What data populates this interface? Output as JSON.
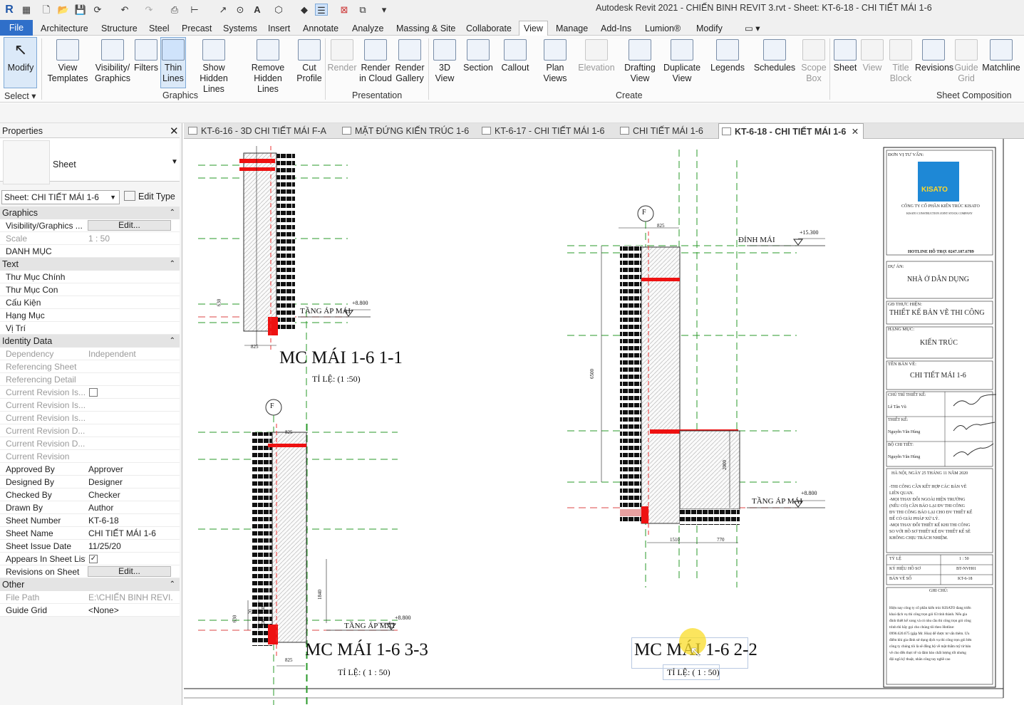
{
  "app": {
    "title": "Autodesk Revit 2021 - CHIẾN BINH REVIT 3.rvt - Sheet: KT-6-18 - CHI TIẾT MÁI 1-6"
  },
  "ribbon_tabs": [
    "File",
    "Architecture",
    "Structure",
    "Steel",
    "Precast",
    "Systems",
    "Insert",
    "Annotate",
    "Analyze",
    "Massing & Site",
    "Collaborate",
    "View",
    "Manage",
    "Add-Ins",
    "Lumion®",
    "Modify"
  ],
  "ribbon": {
    "modify": "Modify",
    "select": "Select",
    "graphics": {
      "label": "Graphics",
      "view_templates_1": "View",
      "view_templates_2": "Templates",
      "visibility_1": "Visibility/",
      "visibility_2": "Graphics",
      "filters": "Filters",
      "thin_1": "Thin",
      "thin_2": "Lines",
      "show_1": "Show",
      "show_2": "Hidden Lines",
      "remove_1": "Remove",
      "remove_2": "Hidden Lines",
      "cut_1": "Cut",
      "cut_2": "Profile"
    },
    "presentation": {
      "label": "Presentation",
      "render": "Render",
      "rcloud_1": "Render",
      "rcloud_2": "in Cloud",
      "rgallery_1": "Render",
      "rgallery_2": "Gallery"
    },
    "create": {
      "label": "Create",
      "view3d_1": "3D",
      "view3d_2": "View",
      "section": "Section",
      "callout": "Callout",
      "plan_1": "Plan",
      "plan_2": "Views",
      "elevation": "Elevation",
      "drafting_1": "Drafting",
      "drafting_2": "View",
      "duplicate_1": "Duplicate",
      "duplicate_2": "View",
      "legends": "Legends",
      "schedules": "Schedules",
      "scope_1": "Scope",
      "scope_2": "Box"
    },
    "sheet_composition": {
      "label": "Sheet Composition",
      "sheet": "Sheet",
      "view": "View",
      "title_1": "Title",
      "title_2": "Block",
      "revisions": "Revisions",
      "guide_1": "Guide",
      "guide_2": "Grid",
      "matchline": "Matchline"
    }
  },
  "properties": {
    "title": "Properties",
    "type_name": "Sheet",
    "selector": "Sheet: CHI TIẾT MÁI 1-6",
    "edit_type": "Edit Type",
    "sections": {
      "graphics": "Graphics",
      "text": "Text",
      "identity": "Identity Data",
      "other": "Other"
    },
    "rows_graphics": [
      {
        "k": "Visibility/Graphics ...",
        "v": "Edit..."
      },
      {
        "k": "Scale",
        "v": "1 : 50"
      },
      {
        "k": "DANH MỤC",
        "v": ""
      }
    ],
    "rows_text": [
      {
        "k": "Thư Mục Chính",
        "v": ""
      },
      {
        "k": "Thư Mục Con",
        "v": ""
      },
      {
        "k": "Cấu Kiện",
        "v": ""
      },
      {
        "k": "Hạng Mục",
        "v": ""
      },
      {
        "k": "Vị Trí",
        "v": ""
      }
    ],
    "rows_identity": [
      {
        "k": "Dependency",
        "v": "Independent"
      },
      {
        "k": "Referencing Sheet",
        "v": ""
      },
      {
        "k": "Referencing Detail",
        "v": ""
      },
      {
        "k": "Current Revision Is...",
        "v": ""
      },
      {
        "k": "Current Revision Is...",
        "v": ""
      },
      {
        "k": "Current Revision Is...",
        "v": ""
      },
      {
        "k": "Current Revision D...",
        "v": ""
      },
      {
        "k": "Current Revision D...",
        "v": ""
      },
      {
        "k": "Current Revision",
        "v": ""
      },
      {
        "k": "Approved By",
        "v": "Approver"
      },
      {
        "k": "Designed By",
        "v": "Designer"
      },
      {
        "k": "Checked By",
        "v": "Checker"
      },
      {
        "k": "Drawn By",
        "v": "Author"
      },
      {
        "k": "Sheet Number",
        "v": "KT-6-18"
      },
      {
        "k": "Sheet Name",
        "v": "CHI TIẾT MÁI 1-6"
      },
      {
        "k": "Sheet Issue Date",
        "v": "11/25/20"
      },
      {
        "k": "Appears In Sheet List",
        "v": ""
      },
      {
        "k": "Revisions on Sheet",
        "v": "Edit..."
      }
    ],
    "rows_other": [
      {
        "k": "File Path",
        "v": "E:\\CHIẾN BINH REVI..."
      },
      {
        "k": "Guide Grid",
        "v": "<None>"
      }
    ]
  },
  "view_tabs": [
    {
      "label": "KT-6-16 - 3D CHI TIẾT MÁI F-A"
    },
    {
      "label": "MẶT ĐỨNG KIẾN TRÚC 1-6"
    },
    {
      "label": "KT-6-17 - CHI TIẾT MÁI 1-6"
    },
    {
      "label": "CHI TIẾT MÁI 1-6"
    },
    {
      "label": "KT-6-18 - CHI TIẾT MÁI 1-6"
    }
  ],
  "drawing": {
    "sec11_title": "MC MÁI 1-6 1-1",
    "sec11_scale": "TỈ LỆ: (1 :50)",
    "sec33_title": "MC MÁI 1-6 3-3",
    "sec33_scale": "TỈ LỆ: ( 1 : 50)",
    "sec22_title": "MC MÁI 1-6 2-2",
    "sec22_scale": "TỈ LỆ: ( 1 : 50)",
    "tang_ap_mai": "TẦNG ÁP MÁI",
    "dinh_mai": "ĐỈNH MÁI",
    "lvl_880": "+8.800",
    "lvl_15300": "+15.300",
    "grid_f": "F",
    "dim_825": "825",
    "dim_630": "630",
    "dim_6500": "6500",
    "dim_2000": "2000",
    "dim_1840": "1840",
    "dim_1510": "1510",
    "dim_770": "770",
    "dim_300": "300",
    "dim_20": "20",
    "dim_230": "230"
  },
  "titleblock": {
    "consultant_label": "ĐƠN VỊ TƯ VẤN:",
    "logo": "KISATO",
    "company": "CÔNG TY CỔ PHẦN KIẾN TRÚC KISATO",
    "company_en": "KISATO CONSTRUCTION JOINT STOCK COMPANY",
    "hotline": "HOTLINE HỖ TRỢ: 0247.107.6789",
    "project_label": "DỰ ÁN:",
    "project": "NHÀ Ở DÂN DỤNG",
    "phase_label": "GĐ THỰC HIỆN:",
    "phase": "THIẾT KẾ BẢN VẼ THI CÔNG",
    "cat_label": "HẠNG MỤC:",
    "category": "KIẾN TRÚC",
    "name_label": "TÊN BẢN VẼ:",
    "sheet_name": "CHI TIẾT MÁI 1-6",
    "chutri_label": "CHỦ TRÌ THIẾT KẾ:",
    "chutri": "Lê Tân Vũ",
    "thietke_label": "THIẾT KẾ:",
    "thietke": "Nguyễn Văn Hùng",
    "bochi_label": "BỘ CHI TIẾT:",
    "bochi": "Nguyễn Văn Hùng",
    "date_note": "HÀ NỘI, NGÀY 25 THÁNG 11 NĂM 2020",
    "note1": "-THI CÔNG CẦN KẾT HỢP CÁC BẢN VẼ",
    "note2": "LIÊN QUAN.",
    "note3": "-MỌI THAY ĐỔI NGOÀI HIỆN TRƯỜNG",
    "note4": "(NẾU CÓ) CẦN BÁO LẠI ĐV THI CÔNG",
    "note5": "ĐV THI CÔNG BÁO LẠI CHO ĐV THIẾT KẾ",
    "note6": "ĐỂ CÓ GIẢI PHÁP XỬ LÝ.",
    "note7": "-MỌI THAY ĐỔI THIẾT KẾ KHI THI CÔNG",
    "note8": "SO VỚI HỒ SƠ THIẾT KẾ ĐV THIẾT KẾ SẼ",
    "note9": "KHÔNG CHỊU TRÁCH NHIỆM.",
    "scale_label": "TỶ LỆ",
    "scale": "1 : 50",
    "code_label": "KÝ HIỆU HỒ SƠ",
    "code": "BT-NVH01",
    "sheet_label": "BẢN VẼ SỐ",
    "sheet_no": "KT-6-18",
    "ghichu_label": "GHI CHÚ:",
    "g1": "Hiện nay công ty cổ phần kiến trúc KISATO đang triển",
    "g2": "khai dịch vụ thi công trọn gói 63 tỉnh thành. Nếu gia",
    "g3": "đình thiết kế xong và có nhu cầu thi công trọn gói công",
    "g4": "trình thì hãy gọi cho chúng tôi theo Hotline:",
    "g5": "0996.620.675 (gặp Mr. Hòa) để được tư vấn thêm. Ưu",
    "g6": "điểm khi gia đình sử dụng dịch vụ thi công trọn gói bên",
    "g7": "công ty chúng tôi là sẽ đồng bộ về mặt thẩm mỹ từ bản",
    "g8": "vẽ cho đến thực tế và đảm bảo chất lượng tốt nhưng",
    "g9": "đội ngũ kỹ thuật, nhân công tay nghề cao"
  }
}
